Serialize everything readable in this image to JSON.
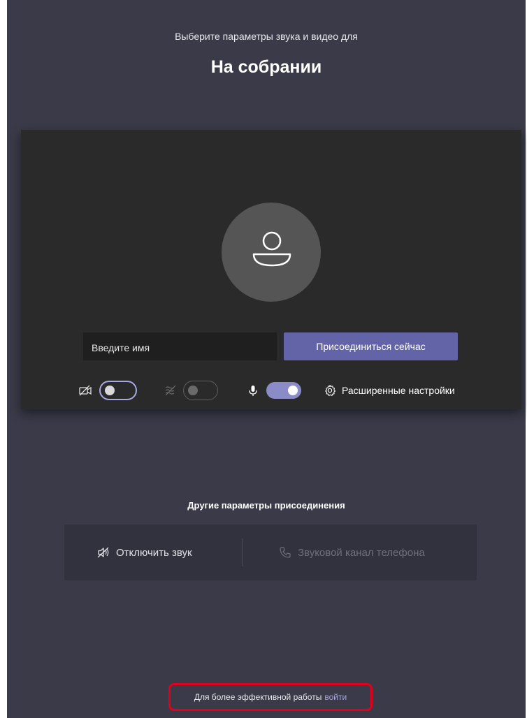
{
  "header": {
    "subtitle": "Выберите параметры звука и видео для",
    "title": "На собрании"
  },
  "prejoin": {
    "name_placeholder": "Введите имя",
    "join_label": "Присоединиться сейчас",
    "camera_on": false,
    "blur_on": false,
    "mic_on": true,
    "settings_label": "Расширенные настройки"
  },
  "other_options": {
    "heading": "Другие параметры присоединения",
    "mute_label": "Отключить звук",
    "phone_label": "Звуковой канал телефона"
  },
  "footer": {
    "text": "Для более эффективной работы",
    "link": "войти"
  },
  "colors": {
    "background": "#3a3a48",
    "accent": "#6264a7",
    "highlight_border": "#e4001b"
  }
}
